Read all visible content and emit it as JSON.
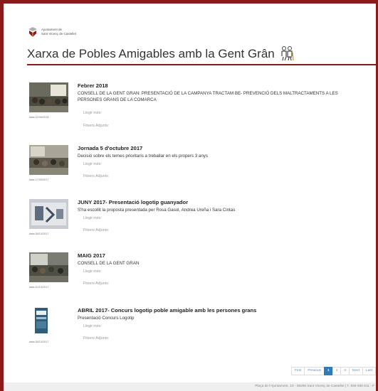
{
  "header": {
    "logo_line1": "Ajuntament de",
    "logo_line2": "Sant Vicenç de Castellet",
    "title": "Xarxa de Pobles Amigables amb la Gent Grân"
  },
  "items": [
    {
      "title": "Febrer 2018",
      "desc": "CONSELL DE LA GENT GRAN: PRESENTACIÓ DE LA CAMPANYA TRACTAM BE- PREVENCIÓ DELS MALTRACTAMENTS A LES PERSONES GRANS DE LA COMARCA",
      "date": "data:02/06/2018",
      "more": "Llegir més:",
      "attach": "Fitxers Adjunts:"
    },
    {
      "title": "Jornada 5 d'octubre 2017",
      "desc": "Decisió sobre els temes prioritaris a treballar en els propers 3 anys",
      "date": "data:17/05/2017",
      "more": "Llegir més:",
      "attach": "Fitxers Adjunts:"
    },
    {
      "title": "JUNY 2017- Presentació logotip guanyador",
      "desc": "S'ha escollit la proposta presentada per Rosa Gasol, Andrea Ureña i Sara Cintas",
      "date": "data:08/13/2017",
      "more": "Llegir més:",
      "attach": "Fitxers Adjunts:"
    },
    {
      "title": "MAIG 2017",
      "desc": "CONSELL DE LA GENT GRAN",
      "date": "data:10/13/2017",
      "more": "Llegir més:",
      "attach": "Fitxers Adjunts:"
    },
    {
      "title": "ABRIL 2017- Concurs logotip poble amigable amb les persones grans",
      "desc": "Presentació Concurs Logotip",
      "date": "data:08/13/2017",
      "more": "Llegir més:",
      "attach": "Fitxers Adjunts:"
    }
  ],
  "pagination": {
    "first": "First",
    "previous": "Previous",
    "p1": "1",
    "p2": "2",
    "p3": "3",
    "next": "Next",
    "last": "Last"
  },
  "footer": {
    "text": "Plaça de l'Ajuntament, 10 - 08295 Sant Vicenç de Castellet | T. 938 930 611 - F"
  },
  "colors": {
    "brand": "#8b1a1a",
    "pager_active": "#337ab7",
    "link": "#5a8fd0"
  }
}
